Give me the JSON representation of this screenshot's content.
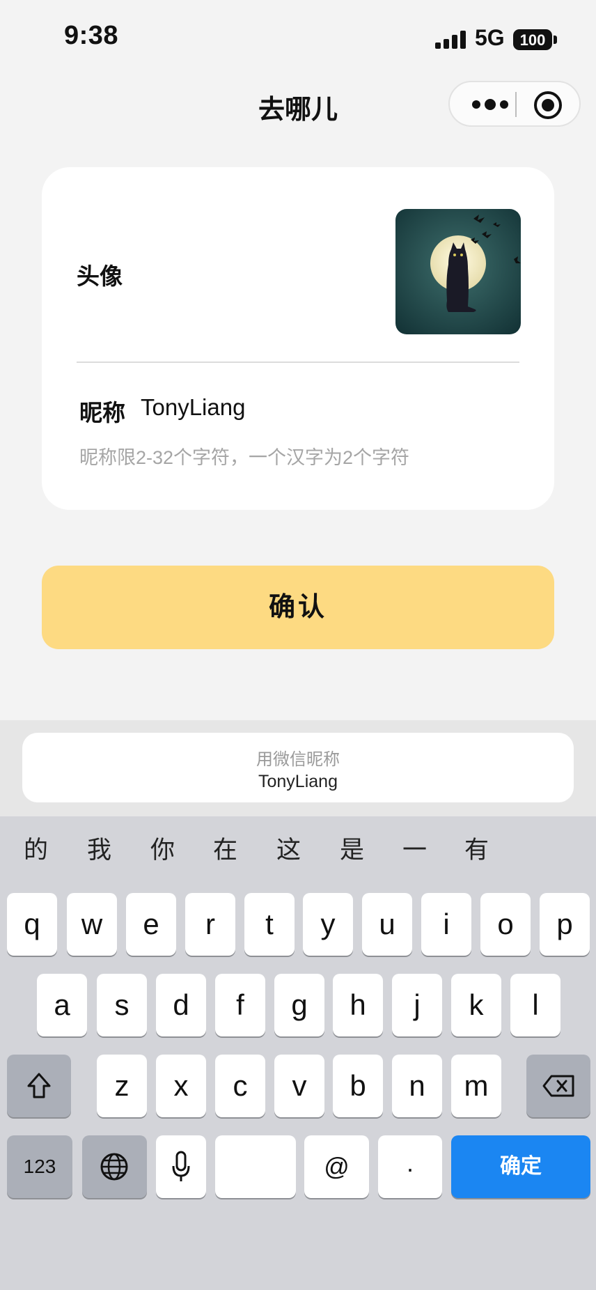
{
  "status_bar": {
    "time": "9:38",
    "network": "5G",
    "battery": "100"
  },
  "nav": {
    "title": "去哪儿"
  },
  "profile": {
    "avatar_label": "头像",
    "nickname_label": "昵称",
    "nickname_value": "TonyLiang",
    "nickname_hint": "昵称限2-32个字符，一个汉字为2个字符"
  },
  "confirm_label": "确认",
  "wechat_suggestion": {
    "title": "用微信昵称",
    "name": "TonyLiang"
  },
  "keyboard": {
    "candidates": [
      "的",
      "我",
      "你",
      "在",
      "这",
      "是",
      "一",
      "有"
    ],
    "row1": [
      "q",
      "w",
      "e",
      "r",
      "t",
      "y",
      "u",
      "i",
      "o",
      "p"
    ],
    "row2": [
      "a",
      "s",
      "d",
      "f",
      "g",
      "h",
      "j",
      "k",
      "l"
    ],
    "row3": [
      "z",
      "x",
      "c",
      "v",
      "b",
      "n",
      "m"
    ],
    "numbers_label": "123",
    "at_label": "@",
    "period_label": ".",
    "done_label": "确定"
  },
  "colors": {
    "page_bg": "#f3f3f3",
    "confirm_bg": "#fdda82",
    "done_key_bg": "#1b86f2",
    "keyboard_bg": "#d3d4d9"
  }
}
